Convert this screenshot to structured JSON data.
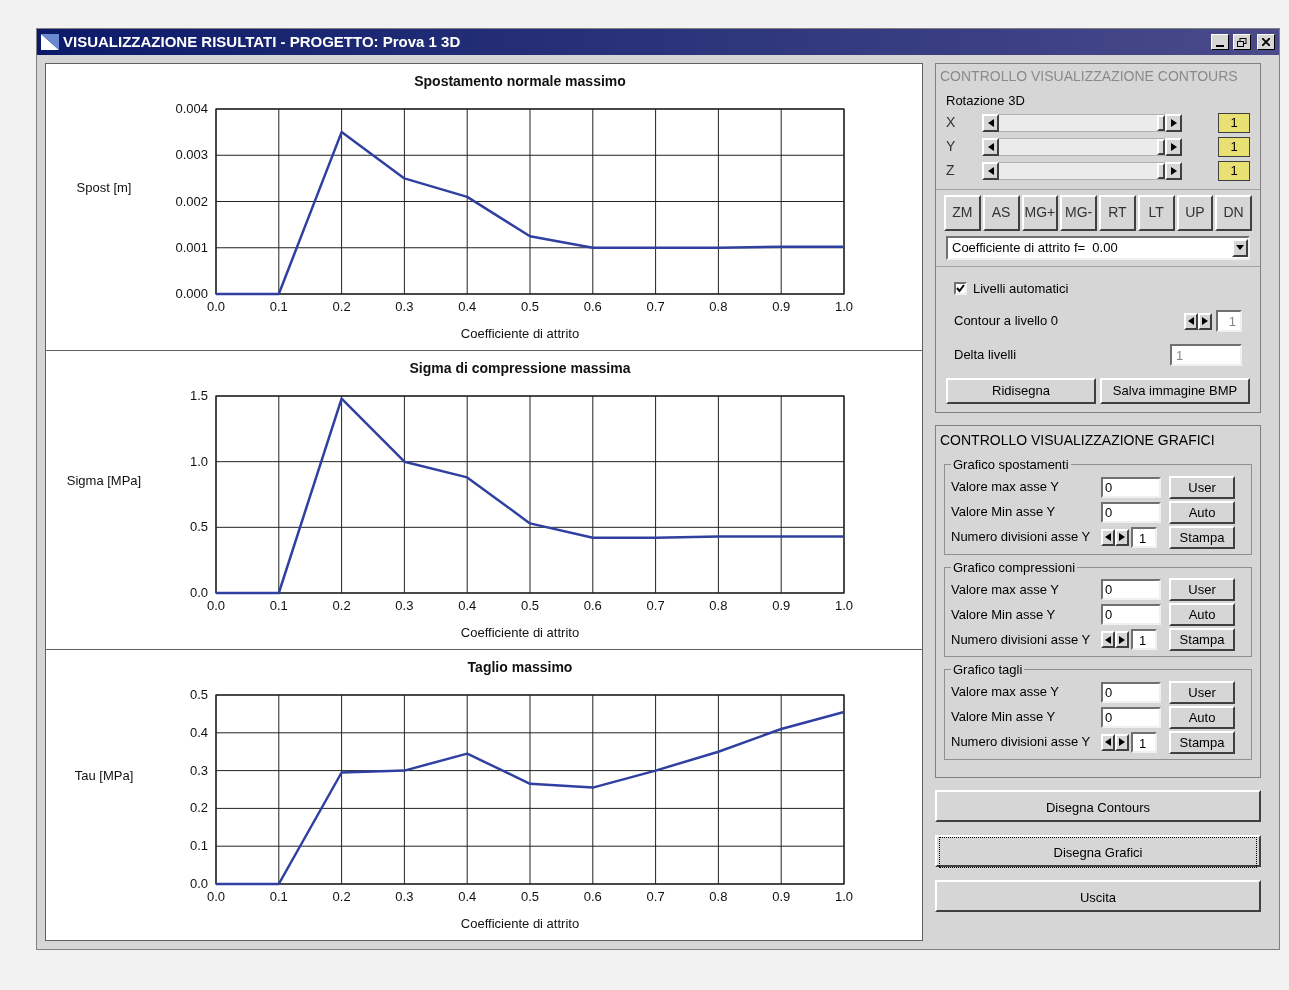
{
  "window": {
    "title": "VISUALIZZAZIONE RISULTATI - PROGETTO: Prova 1 3D"
  },
  "charts": [
    {
      "chart_data": {
        "type": "line",
        "title": "Spostamento normale massimo",
        "xlabel": "Coefficiente di attrito",
        "ylabel": "Spost [m]",
        "x": [
          0,
          0.1,
          0.2,
          0.3,
          0.4,
          0.5,
          0.6,
          0.7,
          0.8,
          0.9,
          1.0
        ],
        "grid": true,
        "series": [
          {
            "color": "#3040a0",
            "values": [
              0,
              0,
              0.0035,
              0.0025,
              0.0021,
              0.00125,
              0.001,
              0.001,
              0.001,
              0.00102,
              0.00102
            ]
          }
        ],
        "xlim": [
          0,
          1
        ],
        "ylim": [
          0,
          0.004
        ],
        "xticks": [
          {
            "value": 0,
            "label": "0.0"
          },
          {
            "value": 0.1,
            "label": "0.1"
          },
          {
            "value": 0.2,
            "label": "0.2"
          },
          {
            "value": 0.3,
            "label": "0.3"
          },
          {
            "value": 0.4,
            "label": "0.4"
          },
          {
            "value": 0.5,
            "label": "0.5"
          },
          {
            "value": 0.6,
            "label": "0.6"
          },
          {
            "value": 0.7,
            "label": "0.7"
          },
          {
            "value": 0.8,
            "label": "0.8"
          },
          {
            "value": 0.9,
            "label": "0.9"
          },
          {
            "value": 1,
            "label": "1.0"
          }
        ],
        "yticks": [
          {
            "value": 0,
            "label": "0.000"
          },
          {
            "value": 0.001,
            "label": "0.001"
          },
          {
            "value": 0.002,
            "label": "0.002"
          },
          {
            "value": 0.003,
            "label": "0.003"
          },
          {
            "value": 0.004,
            "label": "0.004"
          }
        ]
      }
    },
    {
      "chart_data": {
        "type": "line",
        "title": "Sigma di compressione massima",
        "xlabel": "Coefficiente di attrito",
        "ylabel": "Sigma [MPa]",
        "x": [
          0,
          0.1,
          0.2,
          0.3,
          0.4,
          0.5,
          0.6,
          0.7,
          0.8,
          0.9,
          1.0
        ],
        "grid": true,
        "series": [
          {
            "color": "#3040a0",
            "values": [
              0,
              0,
              1.48,
              1.0,
              0.88,
              0.53,
              0.42,
              0.42,
              0.43,
              0.43,
              0.43
            ]
          }
        ],
        "xlim": [
          0,
          1
        ],
        "ylim": [
          0,
          1.5
        ],
        "xticks": [
          {
            "value": 0,
            "label": "0.0"
          },
          {
            "value": 0.1,
            "label": "0.1"
          },
          {
            "value": 0.2,
            "label": "0.2"
          },
          {
            "value": 0.3,
            "label": "0.3"
          },
          {
            "value": 0.4,
            "label": "0.4"
          },
          {
            "value": 0.5,
            "label": "0.5"
          },
          {
            "value": 0.6,
            "label": "0.6"
          },
          {
            "value": 0.7,
            "label": "0.7"
          },
          {
            "value": 0.8,
            "label": "0.8"
          },
          {
            "value": 0.9,
            "label": "0.9"
          },
          {
            "value": 1,
            "label": "1.0"
          }
        ],
        "yticks": [
          {
            "value": 0,
            "label": "0.0"
          },
          {
            "value": 0.5,
            "label": "0.5"
          },
          {
            "value": 1,
            "label": "1.0"
          },
          {
            "value": 1.5,
            "label": "1.5"
          }
        ]
      }
    },
    {
      "chart_data": {
        "type": "line",
        "title": "Taglio massimo",
        "xlabel": "Coefficiente di attrito",
        "ylabel": "Tau [MPa]",
        "x": [
          0,
          0.1,
          0.2,
          0.3,
          0.4,
          0.5,
          0.6,
          0.7,
          0.8,
          0.9,
          1.0
        ],
        "grid": true,
        "series": [
          {
            "color": "#3040a0",
            "values": [
              0,
              0,
              0.295,
              0.3,
              0.345,
              0.265,
              0.255,
              0.3,
              0.35,
              0.41,
              0.455
            ]
          }
        ],
        "xlim": [
          0,
          1
        ],
        "ylim": [
          0,
          0.5
        ],
        "xticks": [
          {
            "value": 0,
            "label": "0.0"
          },
          {
            "value": 0.1,
            "label": "0.1"
          },
          {
            "value": 0.2,
            "label": "0.2"
          },
          {
            "value": 0.3,
            "label": "0.3"
          },
          {
            "value": 0.4,
            "label": "0.4"
          },
          {
            "value": 0.5,
            "label": "0.5"
          },
          {
            "value": 0.6,
            "label": "0.6"
          },
          {
            "value": 0.7,
            "label": "0.7"
          },
          {
            "value": 0.8,
            "label": "0.8"
          },
          {
            "value": 0.9,
            "label": "0.9"
          },
          {
            "value": 1,
            "label": "1.0"
          }
        ],
        "yticks": [
          {
            "value": 0,
            "label": "0.0"
          },
          {
            "value": 0.1,
            "label": "0.1"
          },
          {
            "value": 0.2,
            "label": "0.2"
          },
          {
            "value": 0.3,
            "label": "0.3"
          },
          {
            "value": 0.4,
            "label": "0.4"
          },
          {
            "value": 0.5,
            "label": "0.5"
          }
        ]
      }
    }
  ],
  "contours": {
    "title": "CONTROLLO VISUALIZZAZIONE CONTOURS",
    "disabled": true,
    "rotation_label": "Rotazione 3D",
    "axes": [
      {
        "label": "X",
        "level": 1,
        "value": "1"
      },
      {
        "label": "Y",
        "level": 1,
        "value": "1"
      },
      {
        "label": "Z",
        "level": 1,
        "value": "1"
      }
    ],
    "tool_buttons": [
      "ZM",
      "AS",
      "MG+",
      "MG-",
      "RT",
      "LT",
      "UP",
      "DN"
    ],
    "dropdown": {
      "value": "Coefficiente di attrito f=  0.00"
    },
    "auto_levels": {
      "label": "Livelli automatici",
      "checked": true
    },
    "contour_level": {
      "label": "Contour a livello 0",
      "value": "1"
    },
    "delta": {
      "label": "Delta livelli",
      "value": "1"
    },
    "buttons": [
      "Ridisegna",
      "Salva immagine BMP"
    ]
  },
  "graphs": {
    "title": "CONTROLLO VISUALIZZAZIONE GRAFICI",
    "disabled": false,
    "groups": [
      {
        "title": "Grafico spostamenti",
        "max_label": "Valore max asse Y",
        "max_value": "0",
        "min_label": "Valore Min asse Y",
        "min_value": "0",
        "div_label": "Numero divisioni asse Y",
        "div_value": "1",
        "buttons": [
          "User",
          "Auto",
          "Stampa"
        ]
      },
      {
        "title": "Grafico compressioni",
        "max_label": "Valore max asse Y",
        "max_value": "0",
        "min_label": "Valore Min asse Y",
        "min_value": "0",
        "div_label": "Numero divisioni asse Y",
        "div_value": "1",
        "buttons": [
          "User",
          "Auto",
          "Stampa"
        ]
      },
      {
        "title": "Grafico tagli",
        "max_label": "Valore max asse Y",
        "max_value": "0",
        "min_label": "Valore Min asse Y",
        "min_value": "0",
        "div_label": "Numero divisioni asse Y",
        "div_value": "1",
        "buttons": [
          "User",
          "Auto",
          "Stampa"
        ]
      }
    ]
  },
  "actions": [
    {
      "label": "Disegna Contours",
      "focused": false
    },
    {
      "label": "Disegna Grafici",
      "focused": true
    },
    {
      "label": "Uscita",
      "focused": false
    }
  ]
}
